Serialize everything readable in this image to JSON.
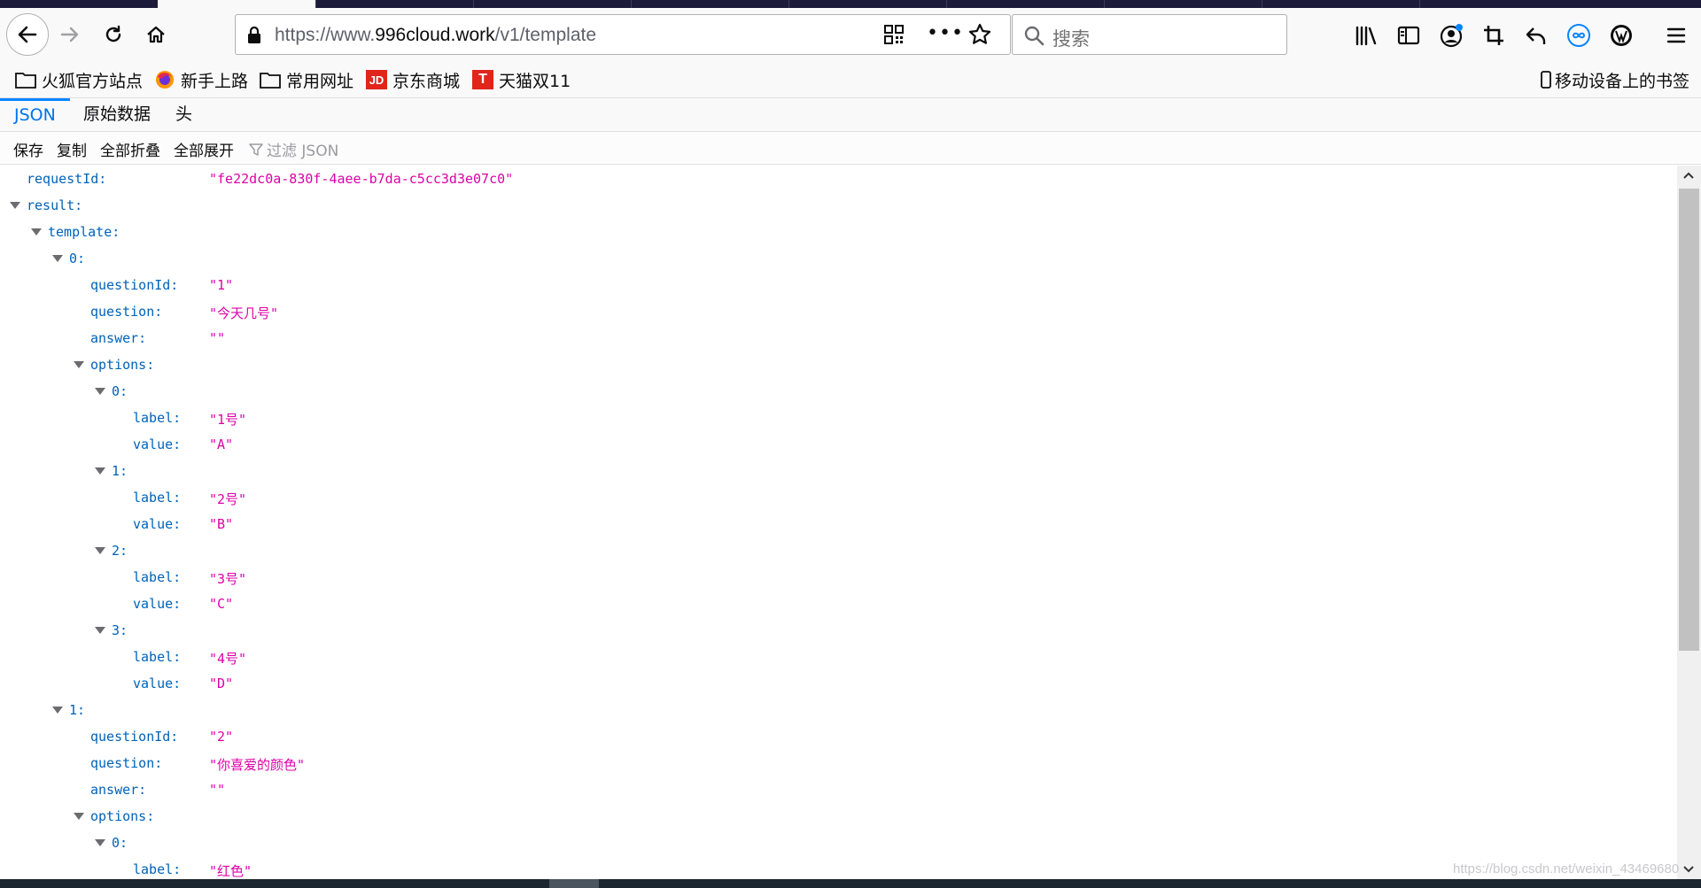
{
  "browser": {
    "url_prefix": "https://www.",
    "url_domain": "996cloud.work",
    "url_path": "/v1/template",
    "more_label": "•••",
    "search_placeholder": "搜索"
  },
  "bookmarks": {
    "items": [
      "火狐官方站点",
      "新手上路",
      "常用网址",
      "京东商城",
      "天猫双11"
    ],
    "mobile": "移动设备上的书签",
    "jd_icon_text": "JD",
    "tmall_icon_text": "T"
  },
  "json_viewer": {
    "tabs": [
      "JSON",
      "原始数据",
      "头"
    ],
    "toolbar": [
      "保存",
      "复制",
      "全部折叠",
      "全部展开"
    ],
    "filter_placeholder": "过滤 JSON"
  },
  "tree": [
    {
      "key": "requestId:",
      "value": "\"fe22dc0a-830f-4aee-b7da-c5cc3d3e07c0\"",
      "depth": 0,
      "toggle": false
    },
    {
      "key": "result:",
      "value": "",
      "depth": 0,
      "toggle": true
    },
    {
      "key": "template:",
      "value": "",
      "depth": 1,
      "toggle": true
    },
    {
      "key": "0:",
      "value": "",
      "depth": 2,
      "toggle": true
    },
    {
      "key": "questionId:",
      "value": "\"1\"",
      "depth": 3,
      "toggle": false
    },
    {
      "key": "question:",
      "value": "\"今天几号\"",
      "depth": 3,
      "toggle": false
    },
    {
      "key": "answer:",
      "value": "\"\"",
      "depth": 3,
      "toggle": false
    },
    {
      "key": "options:",
      "value": "",
      "depth": 3,
      "toggle": true
    },
    {
      "key": "0:",
      "value": "",
      "depth": 4,
      "toggle": true
    },
    {
      "key": "label:",
      "value": "\"1号\"",
      "depth": 5,
      "toggle": false
    },
    {
      "key": "value:",
      "value": "\"A\"",
      "depth": 5,
      "toggle": false
    },
    {
      "key": "1:",
      "value": "",
      "depth": 4,
      "toggle": true
    },
    {
      "key": "label:",
      "value": "\"2号\"",
      "depth": 5,
      "toggle": false
    },
    {
      "key": "value:",
      "value": "\"B\"",
      "depth": 5,
      "toggle": false
    },
    {
      "key": "2:",
      "value": "",
      "depth": 4,
      "toggle": true
    },
    {
      "key": "label:",
      "value": "\"3号\"",
      "depth": 5,
      "toggle": false
    },
    {
      "key": "value:",
      "value": "\"C\"",
      "depth": 5,
      "toggle": false
    },
    {
      "key": "3:",
      "value": "",
      "depth": 4,
      "toggle": true
    },
    {
      "key": "label:",
      "value": "\"4号\"",
      "depth": 5,
      "toggle": false
    },
    {
      "key": "value:",
      "value": "\"D\"",
      "depth": 5,
      "toggle": false
    },
    {
      "key": "1:",
      "value": "",
      "depth": 2,
      "toggle": true
    },
    {
      "key": "questionId:",
      "value": "\"2\"",
      "depth": 3,
      "toggle": false
    },
    {
      "key": "question:",
      "value": "\"你喜爱的颜色\"",
      "depth": 3,
      "toggle": false
    },
    {
      "key": "answer:",
      "value": "\"\"",
      "depth": 3,
      "toggle": false
    },
    {
      "key": "options:",
      "value": "",
      "depth": 3,
      "toggle": true
    },
    {
      "key": "0:",
      "value": "",
      "depth": 4,
      "toggle": true
    },
    {
      "key": "label:",
      "value": "\"红色\"",
      "depth": 5,
      "toggle": false
    }
  ],
  "watermark": "https://blog.csdn.net/weixin_43469680",
  "colors": {
    "key": "#0062b8",
    "string": "#dd00a9",
    "accent": "#0a84ff",
    "tabstrip": "#1c1b3a"
  }
}
